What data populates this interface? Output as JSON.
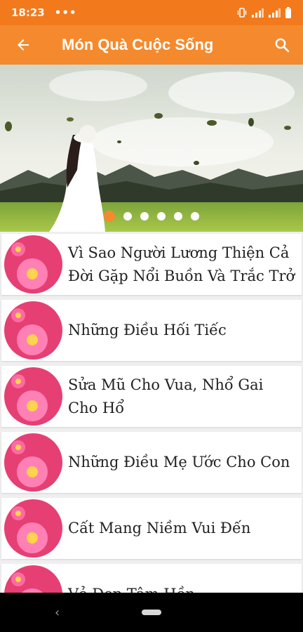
{
  "status_bar": {
    "time": "18:23",
    "overflow": "•••",
    "icons": [
      "vibrate-icon",
      "signal-icon",
      "signal-icon",
      "battery-icon"
    ]
  },
  "app_bar": {
    "title": "Món Quà Cuộc Sống",
    "back_icon": "arrow-left-icon",
    "search_icon": "search-icon"
  },
  "banner": {
    "description_icon": "girl-in-field-image",
    "page_count": 6,
    "active_page": 1
  },
  "items": [
    {
      "label": "Vì Sao Người Lương Thiện Cả Đời Gặp Nổi Buồn Và Trắc Trở"
    },
    {
      "label": "Những Điều Hối Tiếc"
    },
    {
      "label": "Sửa Mũ Cho Vua, Nhổ Gai Cho Hổ"
    },
    {
      "label": "Những Điều Mẹ Ước Cho Con"
    },
    {
      "label": "Cất Mang Niềm Vui Đến"
    },
    {
      "label": "Vẻ Đẹp Tâm Hồn"
    }
  ],
  "colors": {
    "primary": "#f48a2d",
    "status": "#f27a1d",
    "thumb_bg": "#e63f73",
    "flower": "#ff7bb0"
  }
}
